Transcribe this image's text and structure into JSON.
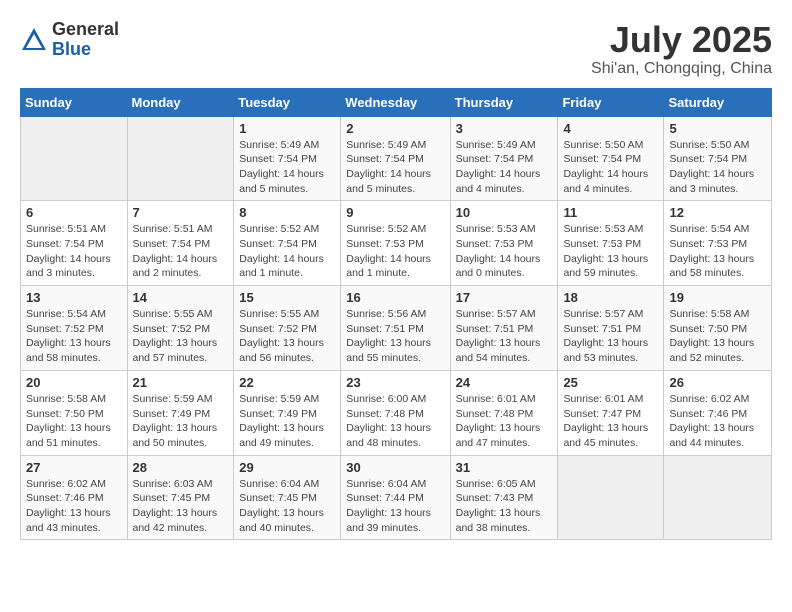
{
  "header": {
    "logo_general": "General",
    "logo_blue": "Blue",
    "month_year": "July 2025",
    "location": "Shi'an, Chongqing, China"
  },
  "calendar": {
    "days_of_week": [
      "Sunday",
      "Monday",
      "Tuesday",
      "Wednesday",
      "Thursday",
      "Friday",
      "Saturday"
    ],
    "weeks": [
      [
        {
          "day": "",
          "info": ""
        },
        {
          "day": "",
          "info": ""
        },
        {
          "day": "1",
          "info": "Sunrise: 5:49 AM\nSunset: 7:54 PM\nDaylight: 14 hours\nand 5 minutes."
        },
        {
          "day": "2",
          "info": "Sunrise: 5:49 AM\nSunset: 7:54 PM\nDaylight: 14 hours\nand 5 minutes."
        },
        {
          "day": "3",
          "info": "Sunrise: 5:49 AM\nSunset: 7:54 PM\nDaylight: 14 hours\nand 4 minutes."
        },
        {
          "day": "4",
          "info": "Sunrise: 5:50 AM\nSunset: 7:54 PM\nDaylight: 14 hours\nand 4 minutes."
        },
        {
          "day": "5",
          "info": "Sunrise: 5:50 AM\nSunset: 7:54 PM\nDaylight: 14 hours\nand 3 minutes."
        }
      ],
      [
        {
          "day": "6",
          "info": "Sunrise: 5:51 AM\nSunset: 7:54 PM\nDaylight: 14 hours\nand 3 minutes."
        },
        {
          "day": "7",
          "info": "Sunrise: 5:51 AM\nSunset: 7:54 PM\nDaylight: 14 hours\nand 2 minutes."
        },
        {
          "day": "8",
          "info": "Sunrise: 5:52 AM\nSunset: 7:54 PM\nDaylight: 14 hours\nand 1 minute."
        },
        {
          "day": "9",
          "info": "Sunrise: 5:52 AM\nSunset: 7:53 PM\nDaylight: 14 hours\nand 1 minute."
        },
        {
          "day": "10",
          "info": "Sunrise: 5:53 AM\nSunset: 7:53 PM\nDaylight: 14 hours\nand 0 minutes."
        },
        {
          "day": "11",
          "info": "Sunrise: 5:53 AM\nSunset: 7:53 PM\nDaylight: 13 hours\nand 59 minutes."
        },
        {
          "day": "12",
          "info": "Sunrise: 5:54 AM\nSunset: 7:53 PM\nDaylight: 13 hours\nand 58 minutes."
        }
      ],
      [
        {
          "day": "13",
          "info": "Sunrise: 5:54 AM\nSunset: 7:52 PM\nDaylight: 13 hours\nand 58 minutes."
        },
        {
          "day": "14",
          "info": "Sunrise: 5:55 AM\nSunset: 7:52 PM\nDaylight: 13 hours\nand 57 minutes."
        },
        {
          "day": "15",
          "info": "Sunrise: 5:55 AM\nSunset: 7:52 PM\nDaylight: 13 hours\nand 56 minutes."
        },
        {
          "day": "16",
          "info": "Sunrise: 5:56 AM\nSunset: 7:51 PM\nDaylight: 13 hours\nand 55 minutes."
        },
        {
          "day": "17",
          "info": "Sunrise: 5:57 AM\nSunset: 7:51 PM\nDaylight: 13 hours\nand 54 minutes."
        },
        {
          "day": "18",
          "info": "Sunrise: 5:57 AM\nSunset: 7:51 PM\nDaylight: 13 hours\nand 53 minutes."
        },
        {
          "day": "19",
          "info": "Sunrise: 5:58 AM\nSunset: 7:50 PM\nDaylight: 13 hours\nand 52 minutes."
        }
      ],
      [
        {
          "day": "20",
          "info": "Sunrise: 5:58 AM\nSunset: 7:50 PM\nDaylight: 13 hours\nand 51 minutes."
        },
        {
          "day": "21",
          "info": "Sunrise: 5:59 AM\nSunset: 7:49 PM\nDaylight: 13 hours\nand 50 minutes."
        },
        {
          "day": "22",
          "info": "Sunrise: 5:59 AM\nSunset: 7:49 PM\nDaylight: 13 hours\nand 49 minutes."
        },
        {
          "day": "23",
          "info": "Sunrise: 6:00 AM\nSunset: 7:48 PM\nDaylight: 13 hours\nand 48 minutes."
        },
        {
          "day": "24",
          "info": "Sunrise: 6:01 AM\nSunset: 7:48 PM\nDaylight: 13 hours\nand 47 minutes."
        },
        {
          "day": "25",
          "info": "Sunrise: 6:01 AM\nSunset: 7:47 PM\nDaylight: 13 hours\nand 45 minutes."
        },
        {
          "day": "26",
          "info": "Sunrise: 6:02 AM\nSunset: 7:46 PM\nDaylight: 13 hours\nand 44 minutes."
        }
      ],
      [
        {
          "day": "27",
          "info": "Sunrise: 6:02 AM\nSunset: 7:46 PM\nDaylight: 13 hours\nand 43 minutes."
        },
        {
          "day": "28",
          "info": "Sunrise: 6:03 AM\nSunset: 7:45 PM\nDaylight: 13 hours\nand 42 minutes."
        },
        {
          "day": "29",
          "info": "Sunrise: 6:04 AM\nSunset: 7:45 PM\nDaylight: 13 hours\nand 40 minutes."
        },
        {
          "day": "30",
          "info": "Sunrise: 6:04 AM\nSunset: 7:44 PM\nDaylight: 13 hours\nand 39 minutes."
        },
        {
          "day": "31",
          "info": "Sunrise: 6:05 AM\nSunset: 7:43 PM\nDaylight: 13 hours\nand 38 minutes."
        },
        {
          "day": "",
          "info": ""
        },
        {
          "day": "",
          "info": ""
        }
      ]
    ]
  }
}
